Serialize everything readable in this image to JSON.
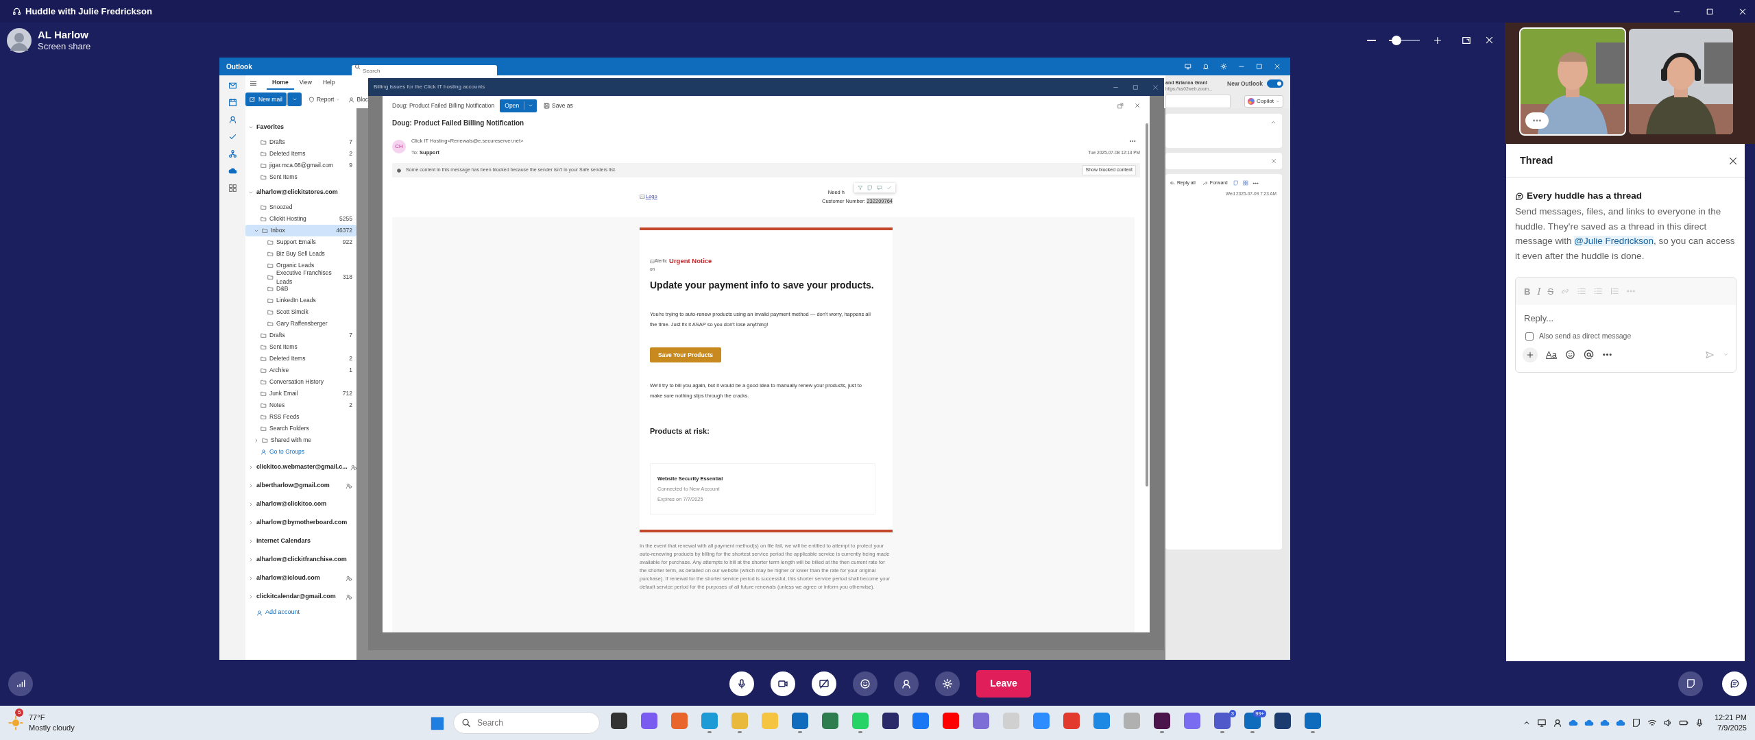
{
  "huddle": {
    "title": "Huddle with Julie Fredrickson",
    "presenter": {
      "name": "AL Harlow",
      "subtitle": "Screen share"
    },
    "zoom": {
      "level": 0.25
    }
  },
  "outlook": {
    "app_name": "Outlook",
    "search": {
      "placeholder": "Search"
    },
    "tabs": [
      {
        "label": "Home",
        "selected": true
      },
      {
        "label": "View",
        "selected": false
      },
      {
        "label": "Help",
        "selected": false
      }
    ],
    "ribbon_buttons": [
      {
        "kind": "primary",
        "label": "New mail"
      },
      {
        "kind": "menu",
        "label": "Report"
      },
      {
        "kind": "plain",
        "label": "Bloc"
      }
    ],
    "navigation": [
      {
        "label": "Favorites",
        "expanded": true,
        "shared": false,
        "children": [
          {
            "kind": "folder",
            "label": "Drafts",
            "count": "7",
            "selected": false
          },
          {
            "kind": "folder",
            "label": "Deleted Items",
            "count": "2",
            "selected": false
          },
          {
            "kind": "folder",
            "label": "jigar.mca.08@gmail.com",
            "count": "9",
            "selected": false
          },
          {
            "kind": "folder",
            "label": "Sent Items",
            "selected": false
          }
        ]
      },
      {
        "label": "alharlow@clickitstores.com",
        "expanded": true,
        "shared": false,
        "children": [
          {
            "kind": "folder",
            "label": "Snoozed",
            "selected": false
          },
          {
            "kind": "folder",
            "label": "Clickit Hosting",
            "count": "5255",
            "selected": false
          },
          {
            "kind": "folder",
            "label": "Inbox",
            "count": "46372",
            "selected": true,
            "expanded": true,
            "children": [
              {
                "kind": "folder",
                "label": "Support Emails",
                "count": "922",
                "selected": false
              },
              {
                "kind": "folder",
                "label": "Biz Buy Sell Leads",
                "selected": false
              },
              {
                "kind": "folder",
                "label": "Organic Leads",
                "selected": false
              },
              {
                "kind": "folder",
                "label": "Executive Franchises Leads",
                "count": "318",
                "selected": false
              },
              {
                "kind": "folder",
                "label": "D&B",
                "selected": false
              },
              {
                "kind": "folder",
                "label": "LinkedIn Leads",
                "selected": false
              },
              {
                "kind": "folder",
                "label": "Scott Simcik",
                "selected": false
              },
              {
                "kind": "folder",
                "label": "Gary Raffensberger",
                "selected": false
              }
            ]
          },
          {
            "kind": "folder",
            "label": "Drafts",
            "count": "7",
            "selected": false
          },
          {
            "kind": "folder",
            "label": "Sent Items",
            "selected": false
          },
          {
            "kind": "folder",
            "label": "Deleted Items",
            "count": "2",
            "selected": false
          },
          {
            "kind": "folder",
            "label": "Archive",
            "count": "1",
            "selected": false
          },
          {
            "kind": "folder",
            "label": "Conversation History",
            "selected": false
          },
          {
            "kind": "folder",
            "label": "Junk Email",
            "count": "712",
            "selected": false
          },
          {
            "kind": "folder",
            "label": "Notes",
            "count": "2",
            "selected": false
          },
          {
            "kind": "folder",
            "label": "RSS Feeds",
            "selected": false
          },
          {
            "kind": "folder",
            "label": "Search Folders",
            "selected": false
          },
          {
            "kind": "folder",
            "label": "Shared with me",
            "selected": false,
            "expanded": false
          },
          {
            "kind": "link",
            "label": "Go to Groups",
            "selected": false
          }
        ]
      },
      {
        "label": "clickitco.webmaster@gmail.c...",
        "expanded": false,
        "shared": true
      },
      {
        "label": "albertharlow@gmail.com",
        "expanded": false,
        "shared": true
      },
      {
        "label": "alharlow@clickitco.com",
        "expanded": false,
        "shared": false
      },
      {
        "label": "alharlow@bymotherboard.com",
        "expanded": false,
        "shared": false
      },
      {
        "label": "Internet Calendars",
        "expanded": false,
        "shared": false
      },
      {
        "label": "alharlow@clickitfranchise.com",
        "expanded": false,
        "shared": false
      },
      {
        "label": "alharlow@icloud.com",
        "expanded": false,
        "shared": true
      },
      {
        "label": "clickitcalendar@gmail.com",
        "expanded": false,
        "shared": true
      }
    ],
    "add_account": "Add account",
    "message_window": {
      "title": "Billing issues for the Click IT hosting accounts",
      "toolbar_subject": "Doug: Product Failed Billing Notification",
      "open_button": "Open",
      "save_as": "Save as",
      "subject": "Doug: Product Failed Billing Notification",
      "sender": {
        "initials": "CH",
        "from": "Click IT Hosting<Renewals@e.secureserver.net>",
        "to_label": "To:",
        "to": "Support",
        "date": "Tue 2025-07-08 12:13 PM"
      },
      "blocked_notice": "Some content in this message has been blocked because the sender isn't in your Safe senders list.",
      "show_blocked": "Show blocked content",
      "email": {
        "logo_alt": "Logo",
        "help_text": "Need h",
        "customer_label": "Customer Number:",
        "customer_number": "232209764",
        "alert_alt": "Alertic",
        "urgent": "Urgent Notice",
        "alert_suffix": "on",
        "headline": "Update your payment info to save your products.",
        "intro": "You're trying to auto-renew products using an invalid payment method — don't worry, happens all the time. Just fix it ASAP so you don't lose anything!",
        "cta": "Save Your Products",
        "followup": "We'll try to bill you again, but it would be a good idea to manually renew your products, just to make sure nothing slips through the cracks.",
        "products_heading": "Products at risk:",
        "products": [
          {
            "name": "Website Security Essential",
            "account": "Connected to New Account",
            "expires": "Expires on 7/7/2025"
          }
        ],
        "legal": "In the event that renewal with all payment method(s) on file fail, we will be entitled to attempt to protect your auto-renewing products by billing for the shortest service period the applicable service is currently being made available for purchase. Any attempts to bill at the shorter term length will be billed at the then current rate for the shorter term, as detailed on our website (which may be higher or lower than the rate for your original purchase). If renewal for the shorter service period is successful, this shorter service period shall become your default service period for the purposes of all future renewals (unless we agree or inform you otherwise)."
      }
    },
    "reading_pane": {
      "participants": "and Brianna Grant",
      "link": "https://us02web.zoom...",
      "new_outlook": {
        "label": "New Outlook",
        "on": true
      },
      "copilot": "Copilot",
      "actions": [
        "Reply all",
        "Forward"
      ],
      "date": "Wed 2025-07-09 7:23 AM"
    }
  },
  "thread": {
    "title": "Thread",
    "heading": "Every huddle has a thread",
    "text_before": "Send messages, files, and links to everyone in the huddle. They're saved as a thread in this direct message with ",
    "mention": "@Julie Fredrickson",
    "text_after": ", so you can access it even after the huddle is done.",
    "composer": {
      "format_letters": [
        "B",
        "I",
        "S"
      ],
      "format_toggle": "Aa",
      "placeholder": "Reply...",
      "also_send": {
        "label": "Also send as direct message",
        "checked": false
      }
    }
  },
  "call_controls": {
    "buttons": [
      {
        "kind": "microphone",
        "on": true
      },
      {
        "kind": "camera",
        "on": true
      },
      {
        "kind": "screen",
        "on": true
      },
      {
        "kind": "reactions",
        "on": false
      },
      {
        "kind": "people",
        "on": false
      },
      {
        "kind": "settings",
        "on": false
      }
    ],
    "leave": "Leave"
  },
  "taskbar": {
    "weather": {
      "badge": "5",
      "temp": "77°F",
      "condition": "Mostly cloudy"
    },
    "search": {
      "placeholder": "Search"
    },
    "apps": [
      {
        "running": false
      },
      {
        "running": false
      },
      {
        "running": false
      },
      {
        "running": true
      },
      {
        "running": true
      },
      {
        "running": false
      },
      {
        "running": true
      },
      {
        "running": false
      },
      {
        "running": true
      },
      {
        "running": false
      },
      {
        "running": false
      },
      {
        "running": false
      },
      {
        "running": false
      },
      {
        "running": false
      },
      {
        "running": false
      },
      {
        "running": false
      },
      {
        "running": false
      },
      {
        "running": false
      },
      {
        "running": true
      },
      {
        "running": false
      },
      {
        "running": true,
        "badge": "3"
      },
      {
        "running": true,
        "badge": "99+"
      },
      {
        "running": false
      },
      {
        "running": true
      }
    ],
    "clock": {
      "time": "12:21 PM",
      "date": "7/9/2025"
    }
  }
}
